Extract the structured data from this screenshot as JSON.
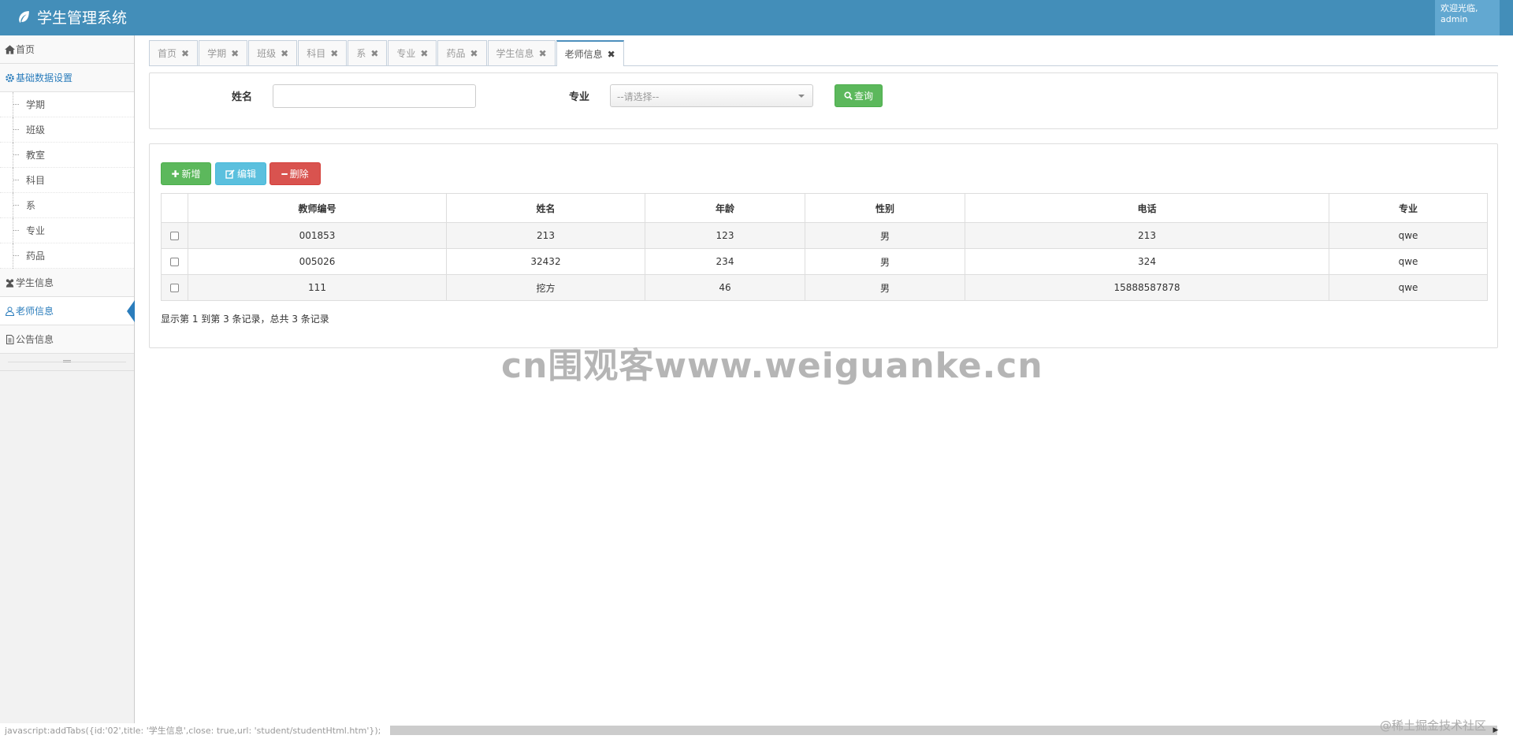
{
  "header": {
    "title": "学生管理系统",
    "welcome": "欢迎光临,",
    "user": "admin"
  },
  "sidebar": {
    "items": [
      {
        "label": "首页"
      },
      {
        "label": "基础数据设置"
      },
      {
        "label": "学生信息"
      },
      {
        "label": "老师信息"
      },
      {
        "label": "公告信息"
      }
    ],
    "sub_items": [
      "学期",
      "班级",
      "教室",
      "科目",
      "系",
      "专业",
      "药品"
    ]
  },
  "tabs": [
    "首页",
    "学期",
    "班级",
    "科目",
    "系",
    "专业",
    "药品",
    "学生信息",
    "老师信息"
  ],
  "tab_close": "✖",
  "search": {
    "name_label": "姓名",
    "name_value": "",
    "major_label": "专业",
    "major_placeholder": "--请选择--",
    "query_label": "查询"
  },
  "toolbar": {
    "add_label": "新增",
    "edit_label": "编辑",
    "delete_label": "删除"
  },
  "table": {
    "columns": [
      "教师编号",
      "姓名",
      "年龄",
      "性别",
      "电话",
      "专业"
    ],
    "rows": [
      [
        "001853",
        "213",
        "123",
        "男",
        "213",
        "qwe"
      ],
      [
        "005026",
        "32432",
        "234",
        "男",
        "324",
        "qwe"
      ],
      [
        "111",
        "挖方",
        "46",
        "男",
        "15888587878",
        "qwe"
      ]
    ]
  },
  "pager": {
    "info": "显示第 1 到第 3 条记录，总共 3 条记录"
  },
  "watermark": "cn围观客www.weiguanke.cn",
  "status_bar": "javascript:addTabs({id:'02',title: '学生信息',close: true,url: 'student/studentHtml.htm'});",
  "footer_mark": "@稀土掘金技术社区",
  "colors": {
    "header": "#438eb9",
    "accent": "#2b7dbc",
    "green": "#5cb85c",
    "blue": "#5bc0de",
    "red": "#d9534f"
  }
}
